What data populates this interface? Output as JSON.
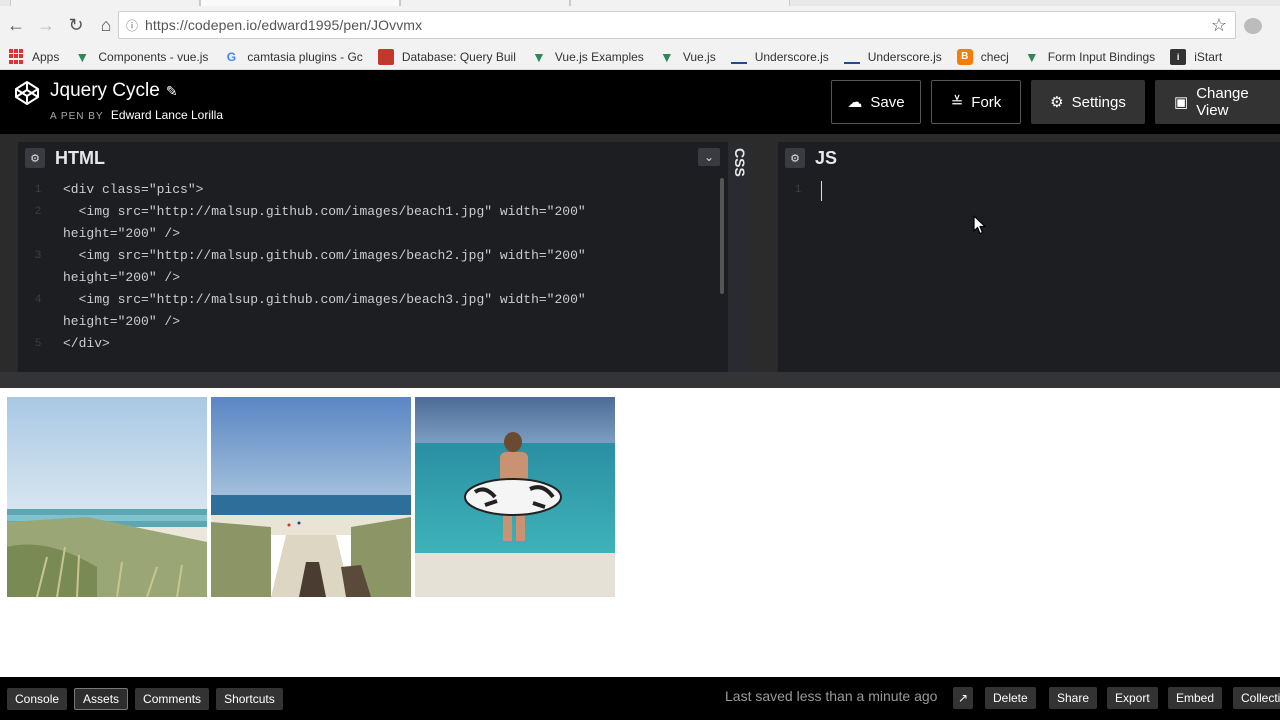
{
  "browser": {
    "url": "https://codepen.io/edward1995/pen/JOvvmx",
    "bookmarks": [
      {
        "label": "Apps",
        "icon": "apps-icon"
      },
      {
        "label": "Components - vue.js",
        "icon": "vue-icon"
      },
      {
        "label": "camtasia plugins - Gc",
        "icon": "google-icon"
      },
      {
        "label": "Database: Query Buil",
        "icon": "database-icon"
      },
      {
        "label": "Vue.js Examples",
        "icon": "vue-icon"
      },
      {
        "label": "Vue.js",
        "icon": "vue-icon"
      },
      {
        "label": "Underscore.js",
        "icon": "underscore-icon"
      },
      {
        "label": "Underscore.js",
        "icon": "underscore-icon"
      },
      {
        "label": "checj",
        "icon": "blogger-icon"
      },
      {
        "label": "Form Input Bindings",
        "icon": "vue-icon"
      },
      {
        "label": "iStart",
        "icon": "istart-icon"
      }
    ]
  },
  "header": {
    "title": "Jquery Cycle",
    "by_label": "A PEN BY",
    "author": "Edward Lance Lorilla",
    "save": "Save",
    "fork": "Fork",
    "settings": "Settings",
    "change_view": "Change View"
  },
  "editors": {
    "html_label": "HTML",
    "css_label": "CSS",
    "js_label": "JS",
    "html_line_numbers": [
      "1",
      "2",
      "3",
      "4",
      "5"
    ],
    "js_line_numbers": [
      "1"
    ],
    "html_code": [
      "<div class=\"pics\">",
      "  <img src=\"http://malsup.github.com/images/beach1.jpg\" width=\"200\"",
      "height=\"200\" />",
      "  <img src=\"http://malsup.github.com/images/beach2.jpg\" width=\"200\"",
      "height=\"200\" />",
      "  <img src=\"http://malsup.github.com/images/beach3.jpg\" width=\"200\"",
      "height=\"200\" />",
      "</div>"
    ]
  },
  "footer": {
    "console": "Console",
    "assets": "Assets",
    "comments": "Comments",
    "shortcuts": "Shortcuts",
    "saved": "Last saved less than a minute ago",
    "delete": "Delete",
    "share": "Share",
    "export": "Export",
    "embed": "Embed",
    "collections": "Collecti"
  }
}
